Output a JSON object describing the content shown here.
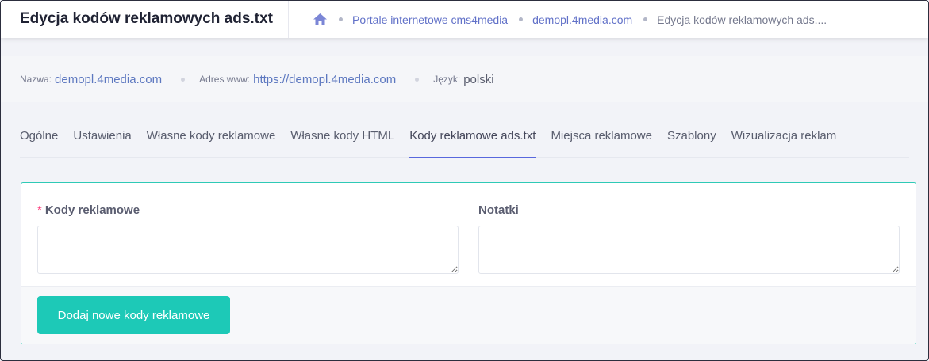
{
  "header": {
    "title": "Edycja kodów reklamowych ads.txt",
    "breadcrumb": [
      "Portale internetowe cms4media",
      "demopl.4media.com",
      "Edycja kodów reklamowych ads...."
    ],
    "home_icon": "home-icon"
  },
  "info": {
    "name_label": "Nazwa:",
    "name_value": "demopl.4media.com",
    "address_label": "Adres www:",
    "address_value": "https://demopl.4media.com",
    "language_label": "Język:",
    "language_value": "polski"
  },
  "tabs": [
    {
      "label": "Ogólne",
      "active": false
    },
    {
      "label": "Ustawienia",
      "active": false
    },
    {
      "label": "Własne kody reklamowe",
      "active": false
    },
    {
      "label": "Własne kody HTML",
      "active": false
    },
    {
      "label": "Kody reklamowe ads.txt",
      "active": true
    },
    {
      "label": "Miejsca reklamowe",
      "active": false
    },
    {
      "label": "Szablony",
      "active": false
    },
    {
      "label": "Wizualizacja reklam",
      "active": false
    }
  ],
  "form": {
    "codes_required_mark": "*",
    "codes_label": "Kody reklamowe",
    "codes_value": "",
    "notes_label": "Notatki",
    "notes_value": "",
    "submit_label": "Dodaj nowe kody reklamowe"
  },
  "colors": {
    "accent": "#5867dd",
    "success": "#1dc9b7",
    "link": "#6171c8",
    "required": "#fd397a"
  }
}
